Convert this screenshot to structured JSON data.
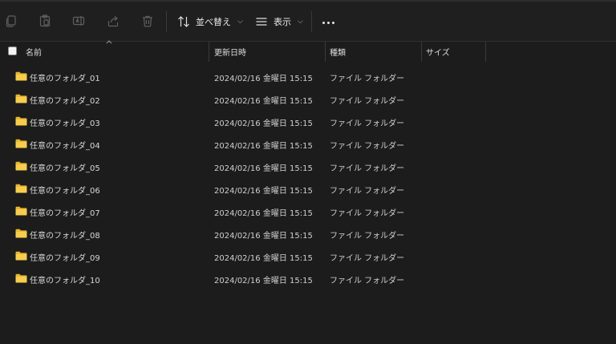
{
  "toolbar": {
    "sort_label": "並べ替え",
    "view_label": "表示",
    "icons": [
      "copy-icon",
      "paste-icon",
      "rename-icon",
      "share-icon",
      "delete-icon",
      "sort-icon",
      "view-icon",
      "more-icon"
    ]
  },
  "columns": {
    "name": "名前",
    "modified": "更新日時",
    "type": "種類",
    "size": "サイズ"
  },
  "colors": {
    "background": "#1c1c1c",
    "folder": "#f4c842",
    "text": "#d8d8d8"
  },
  "files": [
    {
      "name": "任意のフォルダ_01",
      "modified": "2024/02/16 金曜日 15:15",
      "type": "ファイル フォルダー",
      "size": ""
    },
    {
      "name": "任意のフォルダ_02",
      "modified": "2024/02/16 金曜日 15:15",
      "type": "ファイル フォルダー",
      "size": ""
    },
    {
      "name": "任意のフォルダ_03",
      "modified": "2024/02/16 金曜日 15:15",
      "type": "ファイル フォルダー",
      "size": ""
    },
    {
      "name": "任意のフォルダ_04",
      "modified": "2024/02/16 金曜日 15:15",
      "type": "ファイル フォルダー",
      "size": ""
    },
    {
      "name": "任意のフォルダ_05",
      "modified": "2024/02/16 金曜日 15:15",
      "type": "ファイル フォルダー",
      "size": ""
    },
    {
      "name": "任意のフォルダ_06",
      "modified": "2024/02/16 金曜日 15:15",
      "type": "ファイル フォルダー",
      "size": ""
    },
    {
      "name": "任意のフォルダ_07",
      "modified": "2024/02/16 金曜日 15:15",
      "type": "ファイル フォルダー",
      "size": ""
    },
    {
      "name": "任意のフォルダ_08",
      "modified": "2024/02/16 金曜日 15:15",
      "type": "ファイル フォルダー",
      "size": ""
    },
    {
      "name": "任意のフォルダ_09",
      "modified": "2024/02/16 金曜日 15:15",
      "type": "ファイル フォルダー",
      "size": ""
    },
    {
      "name": "任意のフォルダ_10",
      "modified": "2024/02/16 金曜日 15:15",
      "type": "ファイル フォルダー",
      "size": ""
    }
  ]
}
